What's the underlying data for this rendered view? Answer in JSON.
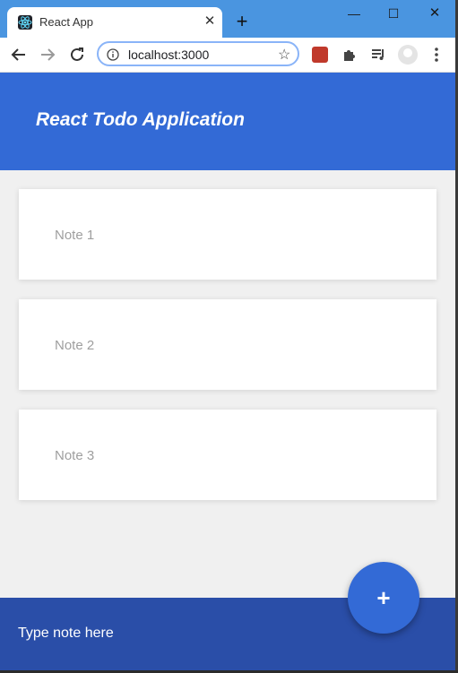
{
  "browser": {
    "tab_title": "React App",
    "tab_close": "✕",
    "new_tab": "+",
    "url": "localhost:3000",
    "accent": "#4a95e0"
  },
  "window_controls": {
    "minimize": "—",
    "maximize": "☐",
    "close": "✕"
  },
  "app": {
    "title": "React Todo Application",
    "header_color": "#336ad6"
  },
  "notes": [
    {
      "text": "Note 1"
    },
    {
      "text": "Note 2"
    },
    {
      "text": "Note 3"
    }
  ],
  "footer": {
    "placeholder": "Type note here",
    "add_label": "+",
    "color": "#2a4ea8"
  }
}
